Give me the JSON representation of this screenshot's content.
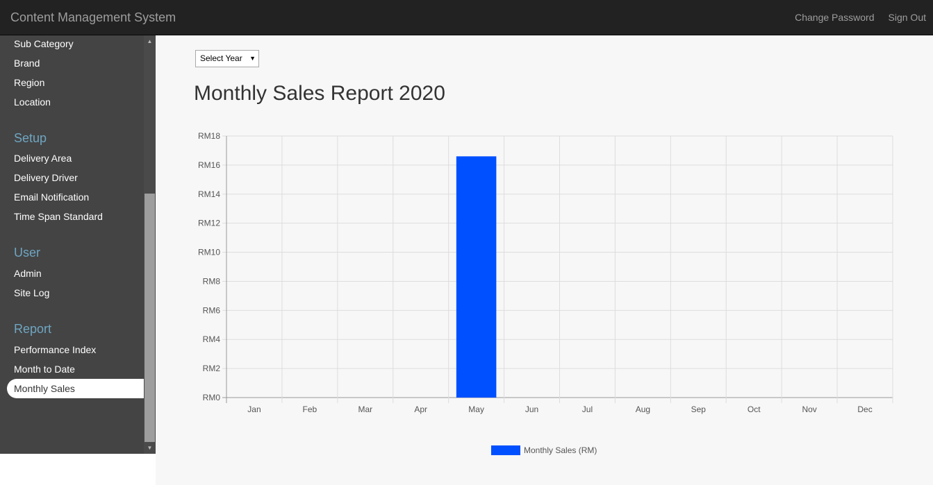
{
  "navbar": {
    "brand": "Content Management System",
    "links": [
      "Change Password",
      "Sign Out"
    ]
  },
  "sidebar": {
    "items_top": [
      "Sub Category",
      "Brand",
      "Region",
      "Location"
    ],
    "sections": [
      {
        "heading": "Setup",
        "items": [
          "Delivery Area",
          "Delivery Driver",
          "Email Notification",
          "Time Span Standard"
        ]
      },
      {
        "heading": "User",
        "items": [
          "Admin",
          "Site Log"
        ]
      },
      {
        "heading": "Report",
        "items": [
          "Performance Index",
          "Month to Date"
        ]
      }
    ],
    "active_item": "Monthly Sales"
  },
  "filter": {
    "year_select": "Select Year"
  },
  "page_title": "Monthly Sales Report 2020",
  "colors": {
    "bar": "#0050ff",
    "heading": "#6fa6c2",
    "navbar": "#222222",
    "sidebar": "#444444"
  },
  "chart_data": {
    "type": "bar",
    "categories": [
      "Jan",
      "Feb",
      "Mar",
      "Apr",
      "May",
      "Jun",
      "Jul",
      "Aug",
      "Sep",
      "Oct",
      "Nov",
      "Dec"
    ],
    "series": [
      {
        "name": "Monthly Sales (RM)",
        "values": [
          0,
          0,
          0,
          0,
          16.6,
          0,
          0,
          0,
          0,
          0,
          0,
          0
        ]
      }
    ],
    "yticks": [
      "RM0",
      "RM2",
      "RM4",
      "RM6",
      "RM8",
      "RM10",
      "RM12",
      "RM14",
      "RM16",
      "RM18"
    ],
    "ylim": [
      0,
      18
    ],
    "grid": true,
    "legend": "bottom"
  }
}
